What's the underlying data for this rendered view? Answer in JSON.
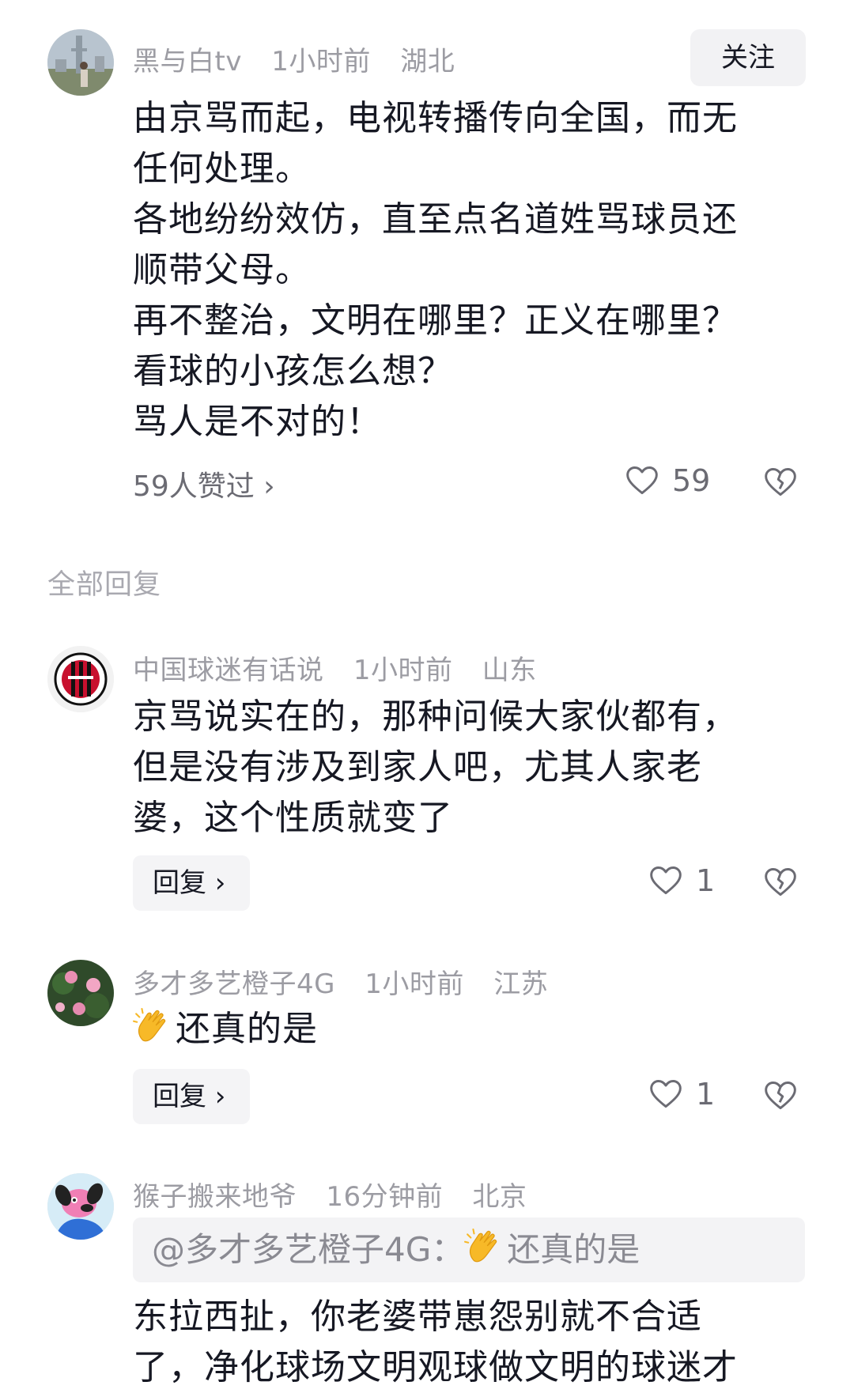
{
  "comment_main": {
    "username": "黑与白tv",
    "time": "1小时前",
    "location": "湖北",
    "follow_label": "关注",
    "lines": [
      "由京骂而起，电视转播传向全国，而无",
      "任何处理。",
      "各地纷纷效仿，直至点名道姓骂球员还",
      "顺带父母。",
      "再不整治，文明在哪里？正义在哪里？",
      "看球的小孩怎么想？",
      "骂人是不对的！"
    ],
    "likes_link": "59人赞过 ›",
    "like_count": "59"
  },
  "section": {
    "label": "全部回复"
  },
  "replies": [
    {
      "username": "中国球迷有话说",
      "time": "1小时前",
      "location": "山东",
      "lines": [
        "京骂说实在的，那种问候大家伙都有，",
        "但是没有涉及到家人吧，尤其人家老",
        "婆，这个性质就变了"
      ],
      "reply_label": "回复 ›",
      "like_count": "1"
    },
    {
      "username": "多才多艺橙子4G",
      "time": "1小时前",
      "location": "江苏",
      "text": "还真的是",
      "emoji": "clapping-hands-emoji",
      "reply_label": "回复 ›",
      "like_count": "1"
    },
    {
      "username": "猴子搬来地爷",
      "time": "16分钟前",
      "location": "北京",
      "quote_prefix": "@多才多艺橙子4G：",
      "quote_text": "还真的是",
      "lines": [
        "东拉西扯，你老婆带崽怨别就不合适",
        "了，净化球场文明观球做文明的球迷才"
      ]
    }
  ],
  "icons": {
    "like": "heart-outline-icon",
    "dislike": "broken-heart-icon"
  },
  "colors": {
    "text": "#161823",
    "meta": "#9c9ca3",
    "button_bg": "#f2f2f4"
  }
}
